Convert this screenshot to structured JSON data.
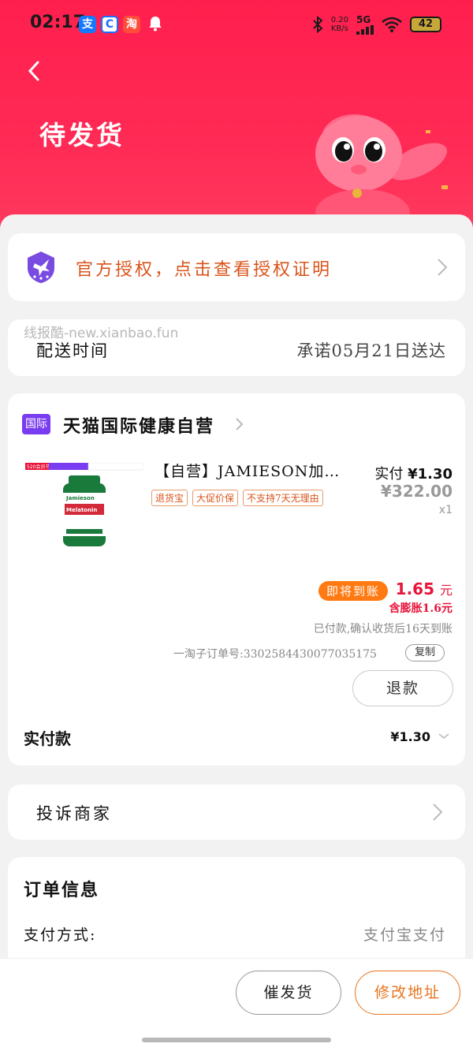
{
  "status_bar": {
    "time": "02:17",
    "net_speed_value": "0.20",
    "net_speed_unit": "KB/s",
    "network": "5G",
    "battery": "42",
    "app_icons": [
      "alipay-icon",
      "circle-app-icon",
      "tmall-app-icon",
      "bell-icon"
    ]
  },
  "header": {
    "title": "待发货",
    "colors": {
      "gradient_top": "#ff1f4e",
      "gradient_bottom": "#ff3a5f"
    }
  },
  "auth_banner": {
    "text": "官方授权，点击查看授权证明"
  },
  "watermark": "线报酷-new.xianbao.fun",
  "delivery": {
    "label": "配送时间",
    "value": "承诺05月21日送达"
  },
  "shop": {
    "badge": "国际",
    "name": "天猫国际健康自营"
  },
  "product": {
    "title": "【自营】JAMIESON加…",
    "tags": [
      "退货宝",
      "大促价保",
      "不支持7天无理由"
    ],
    "paid_label": "实付",
    "paid_price": "¥1.30",
    "original_price": "¥322.00",
    "quantity": "x1",
    "image_brand": "Jamieson",
    "image_product": "Melatonin",
    "image_banner": "520会员节"
  },
  "arrival": {
    "pill": "即将到账",
    "amount": "1.65",
    "unit": "元",
    "inflate_note": "含膨胀1.6元",
    "settle_note": "已付款,确认收货后16天到账"
  },
  "order_number": {
    "text": "一淘子订单号:3302584430077035175",
    "copy_label": "复制"
  },
  "refund_button": "退款",
  "paid_total": {
    "label": "实付款",
    "amount": "¥1.30"
  },
  "complain": {
    "label": "投诉商家"
  },
  "order_info": {
    "title": "订单信息",
    "rows": [
      {
        "label": "支付方式:",
        "value": "支付宝支付"
      }
    ]
  },
  "bottom_actions": {
    "urge": "催发货",
    "change_address": "修改地址"
  },
  "colors": {
    "accent_orange": "#d9541b",
    "price_red": "#e8143a",
    "badge_purple": "#7a3cf0"
  }
}
